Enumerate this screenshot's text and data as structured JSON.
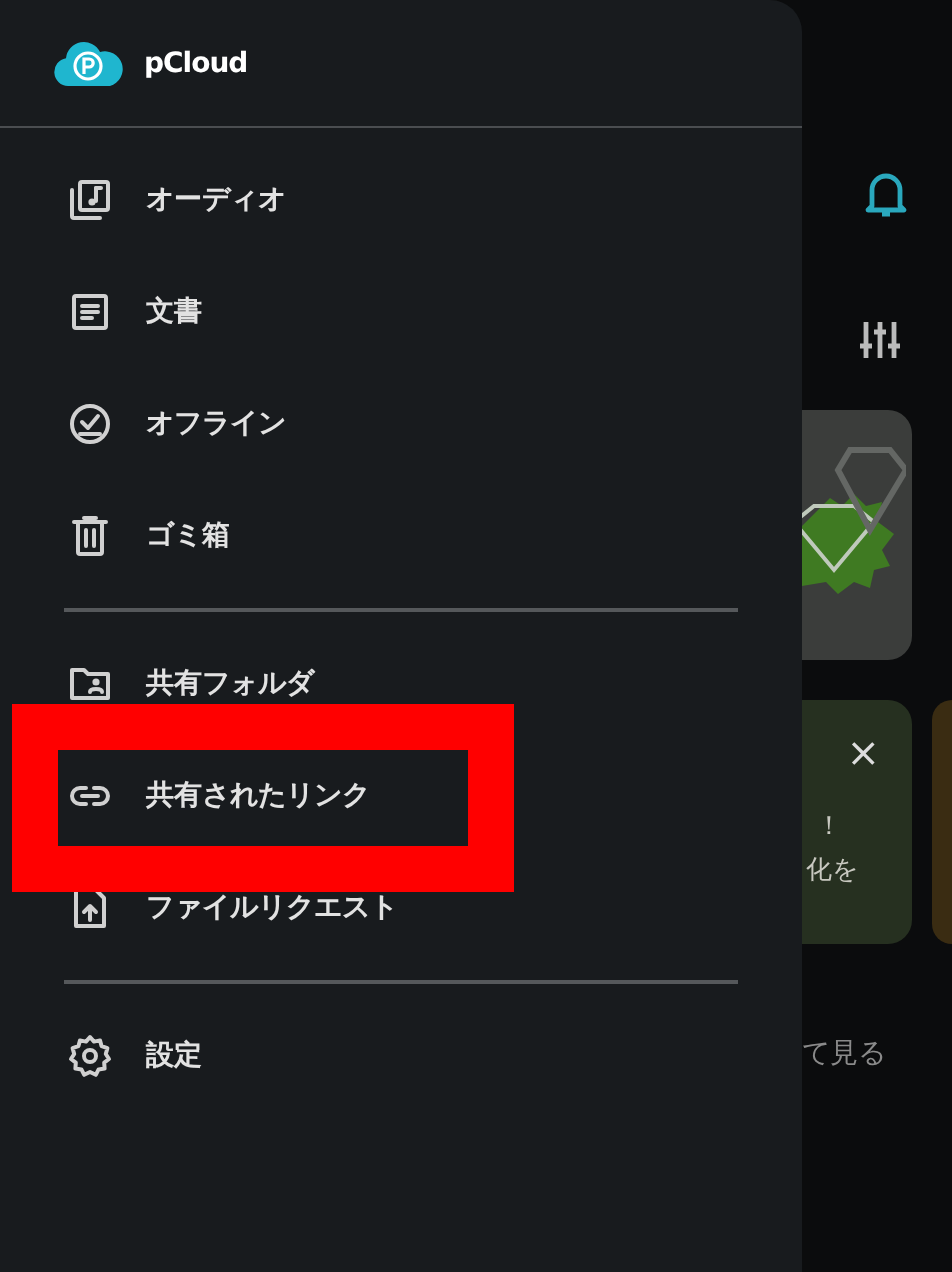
{
  "app": {
    "name": "pCloud"
  },
  "sections": [
    {
      "items": [
        {
          "label": "オーディオ",
          "highlighted": false
        },
        {
          "label": "文書",
          "highlighted": false
        },
        {
          "label": "オフライン",
          "highlighted": false
        },
        {
          "label": "ゴミ箱",
          "highlighted": false
        }
      ]
    },
    {
      "items": [
        {
          "label": "共有フォルダ",
          "highlighted": false
        },
        {
          "label": "共有されたリンク",
          "highlighted": true
        },
        {
          "label": "ファイルリクエスト",
          "highlighted": false
        }
      ]
    },
    {
      "items": [
        {
          "label": "設定",
          "highlighted": false
        }
      ]
    }
  ],
  "background": {
    "notification_card": {
      "close": "×",
      "texts": [
        "！",
        "化を"
      ]
    },
    "link": "て見る"
  }
}
